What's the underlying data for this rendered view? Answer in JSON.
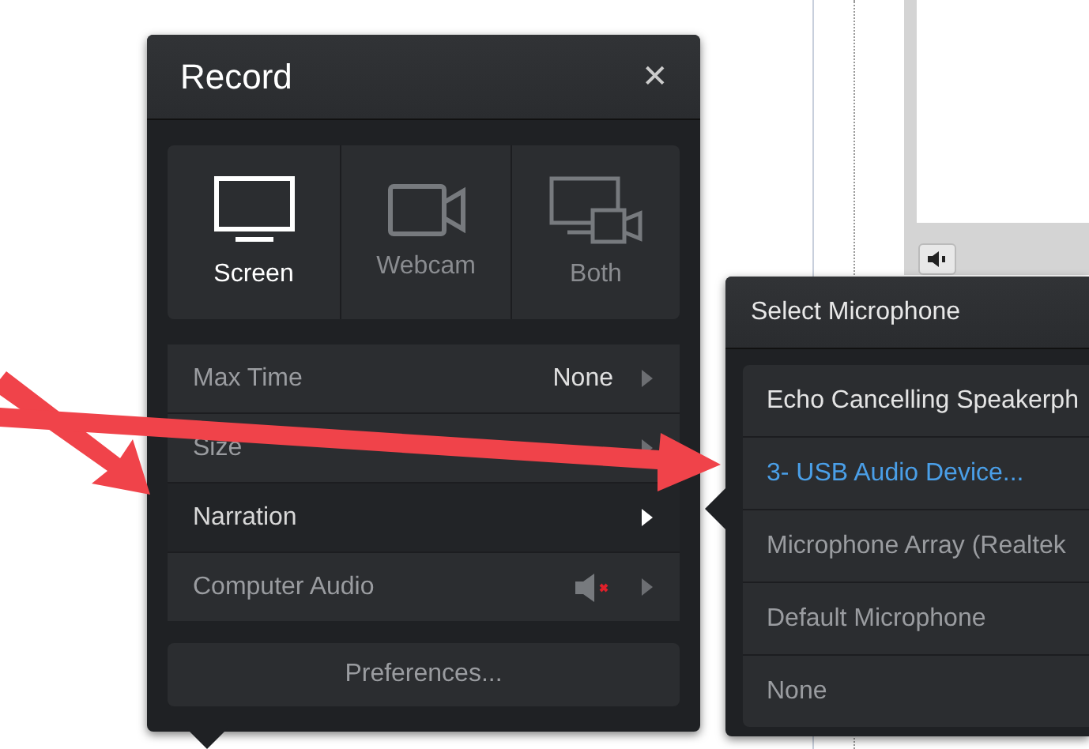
{
  "record_panel": {
    "title": "Record",
    "close": "✕",
    "modes": [
      {
        "label": "Screen",
        "kind": "screen",
        "selected": true
      },
      {
        "label": "Webcam",
        "kind": "webcam",
        "selected": false
      },
      {
        "label": "Both",
        "kind": "both",
        "selected": false
      }
    ],
    "settings": [
      {
        "label": "Max Time",
        "value": "None",
        "kind": "value",
        "selected": false
      },
      {
        "label": "Size",
        "kind": "value",
        "selected": false
      },
      {
        "label": "Narration",
        "kind": "value",
        "selected": true
      },
      {
        "label": "Computer Audio",
        "kind": "audio",
        "muted": true,
        "selected": false
      }
    ],
    "preferences_button": "Preferences..."
  },
  "microphone_panel": {
    "title": "Select Microphone",
    "options": [
      {
        "label": "Echo Cancelling Speakerph",
        "selected": false
      },
      {
        "label": "3- USB Audio Device...",
        "selected": true
      },
      {
        "label": "Microphone Array (Realtek",
        "selected": false
      },
      {
        "label": "Default Microphone",
        "selected": false
      },
      {
        "label": "None",
        "selected": false
      }
    ]
  }
}
